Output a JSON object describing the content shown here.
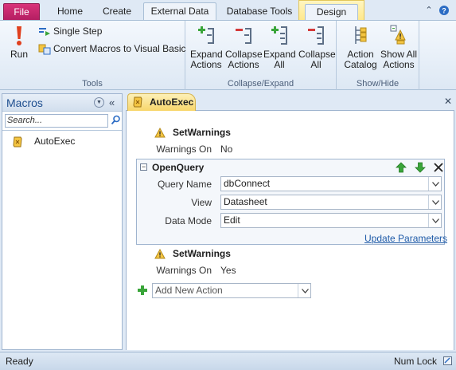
{
  "ribbon_tabs": {
    "file": "File",
    "home": "Home",
    "create": "Create",
    "external_data": "External Data",
    "database_tools": "Database Tools",
    "design": "Design",
    "selected": "External Data",
    "contextual": "Design"
  },
  "ribbon": {
    "tools": {
      "label": "Tools",
      "run": "Run",
      "single_step": "Single Step",
      "convert_macros": "Convert Macros to Visual Basic"
    },
    "collapse_expand": {
      "label": "Collapse/Expand",
      "expand_actions": [
        "Expand",
        "Actions"
      ],
      "collapse_actions": [
        "Collapse",
        "Actions"
      ],
      "expand_all": [
        "Expand",
        "All"
      ],
      "collapse_all": [
        "Collapse",
        "All"
      ]
    },
    "show_hide": {
      "label": "Show/Hide",
      "action_catalog": [
        "Action",
        "Catalog"
      ],
      "show_all_actions": [
        "Show All",
        "Actions"
      ]
    }
  },
  "nav_pane": {
    "title": "Macros",
    "search_placeholder": "Search...",
    "items": [
      {
        "label": "AutoExec",
        "icon": "macro-icon"
      }
    ]
  },
  "document": {
    "tab_label": "AutoExec",
    "actions": [
      {
        "name": "SetWarnings",
        "args": [
          {
            "label": "Warnings On",
            "value": "No"
          }
        ]
      },
      {
        "name": "OpenQuery",
        "expanded": true,
        "args": [
          {
            "label": "Query Name",
            "value": "dbConnect"
          },
          {
            "label": "View",
            "value": "Datasheet"
          },
          {
            "label": "Data Mode",
            "value": "Edit"
          }
        ],
        "link": "Update Parameters"
      },
      {
        "name": "SetWarnings",
        "args": [
          {
            "label": "Warnings On",
            "value": "Yes"
          }
        ]
      }
    ],
    "add_new_action": "Add New Action"
  },
  "status_bar": {
    "left": "Ready",
    "right": "Num Lock"
  },
  "colors": {
    "file_tab": "#c42a6e",
    "accent_blue": "#1f5ba8",
    "tab_yellow": "#f8d66a",
    "green_plus": "#3aa53a",
    "red_minus": "#d43a3a"
  }
}
